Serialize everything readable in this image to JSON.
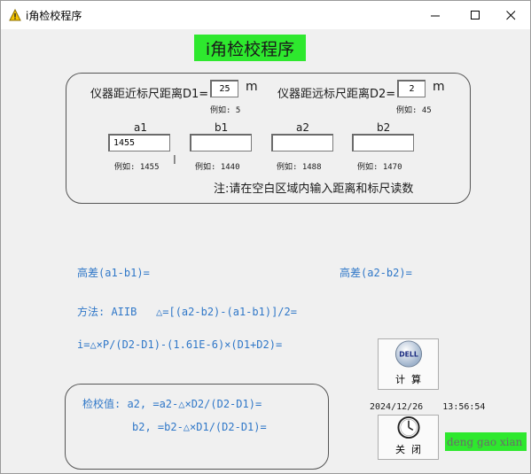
{
  "window": {
    "title": "i角检校程序",
    "minimize": "—",
    "maximize": "☐",
    "close": "✕"
  },
  "banner": "i角检校程序",
  "distances": {
    "near_label": "仪器距近标尺距离D1=",
    "near_value": "25",
    "near_unit": "m",
    "near_example": "例如: 5",
    "far_label": "仪器距远标尺距离D2=",
    "far_value": "2",
    "far_unit": "m",
    "far_example": "例如: 45"
  },
  "readings": [
    {
      "label": "a1",
      "value": "1455",
      "example": "例如: 1455"
    },
    {
      "label": "b1",
      "value": "",
      "example": "例如: 1440"
    },
    {
      "label": "a2",
      "value": "",
      "example": "例如: 1488"
    },
    {
      "label": "b2",
      "value": "",
      "example": "例如: 1470"
    }
  ],
  "note": "注:请在空白区域内输入距离和标尺读数",
  "results": {
    "diff1": "高差(a1-b1)=",
    "diff2": "高差(a2-b2)=",
    "method": "方法: AIIB   △=[(a2-b2)-(a1-b1)]/2=",
    "iformula": "i=△×P/(D2-D1)-(1.61E-6)×(D1+D2)="
  },
  "check": {
    "line1": "检校值: a2,  =a2-△×D2/(D2-D1)=",
    "line2": "b2,  =b2-△×D1/(D2-D1)="
  },
  "buttons": {
    "calc": "计  算",
    "close": "关  闭",
    "calc_icon_text": "DELL"
  },
  "timestamp": {
    "date": "2024/12/26",
    "time": "13:56:54"
  },
  "footer_text": "deng gao xian",
  "colors": {
    "banner": "#2ee82e",
    "result_text": "#2f77c8"
  }
}
